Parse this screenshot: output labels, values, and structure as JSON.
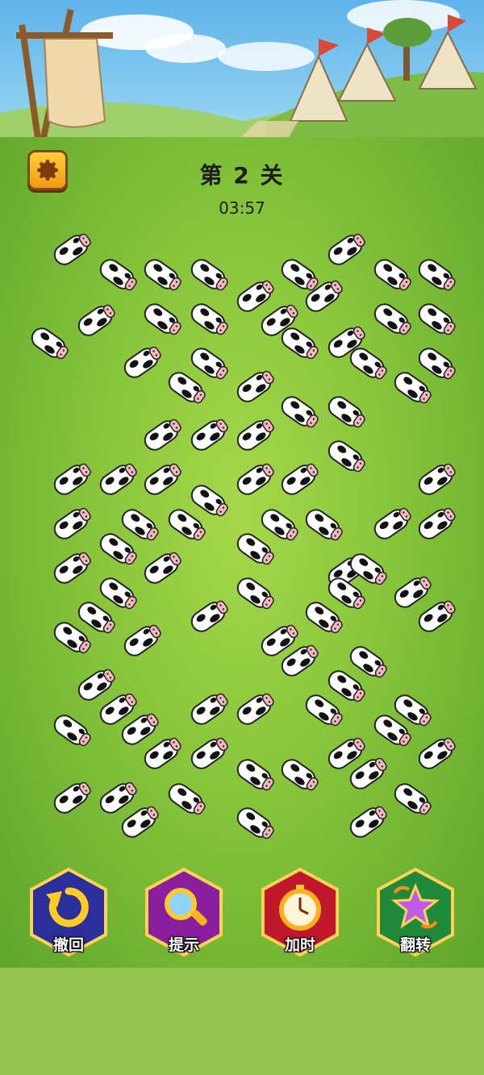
{
  "hud": {
    "level_title": "第 2 关",
    "timer": "03:57"
  },
  "icons": {
    "settings": "gear-icon",
    "undo": "undo-arrow-icon",
    "hint": "magnifier-icon",
    "add_time": "stopwatch-icon",
    "flip": "star-flip-icon"
  },
  "toolbar": {
    "undo_label": "撤回",
    "hint_label": "提示",
    "add_time_label": "加时",
    "flip_label": "翻转"
  },
  "colors": {
    "undo": "#2a2f9a",
    "hint": "#8a1f9e",
    "add_time": "#c0182a",
    "flip": "#1f8a3a",
    "settings": "#f5b020"
  }
}
